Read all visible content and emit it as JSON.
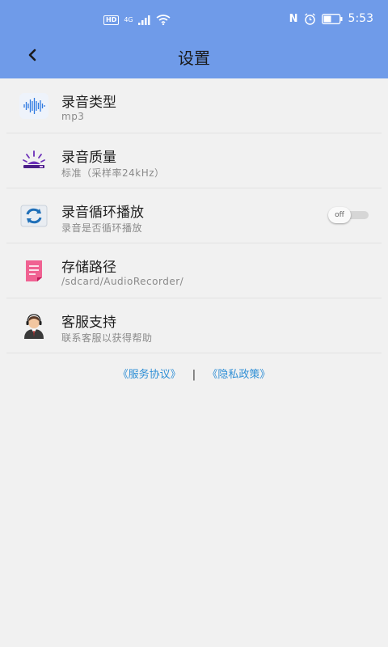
{
  "status_bar": {
    "hd": "HD",
    "network": "4G",
    "nfc": "N",
    "time": "5:53"
  },
  "header": {
    "title": "设置",
    "back_icon": "chevron-left-icon",
    "background": "#6f9be9"
  },
  "settings": [
    {
      "key": "record-type",
      "title": "录音类型",
      "subtitle": "mp3",
      "icon": "waveform-icon"
    },
    {
      "key": "record-quality",
      "title": "录音质量",
      "subtitle": "标准（采样率24kHz）",
      "icon": "quality-lamp-icon"
    },
    {
      "key": "record-loop",
      "title": "录音循环播放",
      "subtitle": "录音是否循环播放",
      "icon": "loop-icon",
      "toggle": {
        "label": "off",
        "state": "off"
      }
    },
    {
      "key": "storage-path",
      "title": "存储路径",
      "subtitle": "/sdcard/AudioRecorder/",
      "icon": "folder-note-icon"
    },
    {
      "key": "support",
      "title": "客服支持",
      "subtitle": "联系客服以获得帮助",
      "icon": "support-agent-icon"
    }
  ],
  "footer": {
    "service_agreement": "《服务协议》",
    "separator": "|",
    "privacy_policy": "《隐私政策》",
    "link_color": "#2f8fd6"
  }
}
